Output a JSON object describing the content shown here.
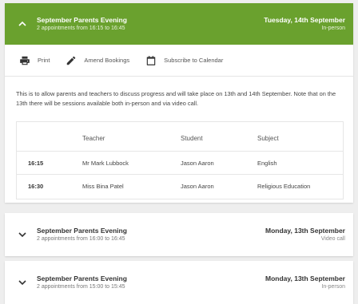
{
  "events": [
    {
      "title": "September Parents Evening",
      "subtitle": "2 appointments from 16:15 to 16:45",
      "date": "Tuesday, 14th September",
      "mode": "In-person",
      "expanded": true,
      "toolbar": {
        "print_label": "Print",
        "amend_label": "Amend Bookings",
        "subscribe_label": "Subscribe to Calendar"
      },
      "description": "This is to allow parents and teachers to discuss progress and will take place on 13th and 14th September. Note that on the 13th there will be sessions available both in-person and via video call.",
      "table": {
        "headers": {
          "time": "",
          "teacher": "Teacher",
          "student": "Student",
          "subject": "Subject"
        },
        "rows": [
          {
            "time": "16:15",
            "teacher": "Mr Mark Lubbock",
            "student": "Jason Aaron",
            "subject": "English"
          },
          {
            "time": "16:30",
            "teacher": "Miss Bina Patel",
            "student": "Jason Aaron",
            "subject": "Religious Education"
          }
        ]
      }
    },
    {
      "title": "September Parents Evening",
      "subtitle": "2 appointments from 16:00 to 16:45",
      "date": "Monday, 13th September",
      "mode": "Video call",
      "expanded": false
    },
    {
      "title": "September Parents Evening",
      "subtitle": "2 appointments from 15:00 to 15:45",
      "date": "Monday, 13th September",
      "mode": "In-person",
      "expanded": false
    }
  ],
  "icons": {
    "collapse": "chevron-up-icon",
    "expand": "chevron-down-icon",
    "print": "printer-icon",
    "amend": "pencil-icon",
    "subscribe": "calendar-icon"
  },
  "colors": {
    "header_active": "#6aa12e",
    "background": "#eeeeee",
    "card": "#ffffff"
  }
}
